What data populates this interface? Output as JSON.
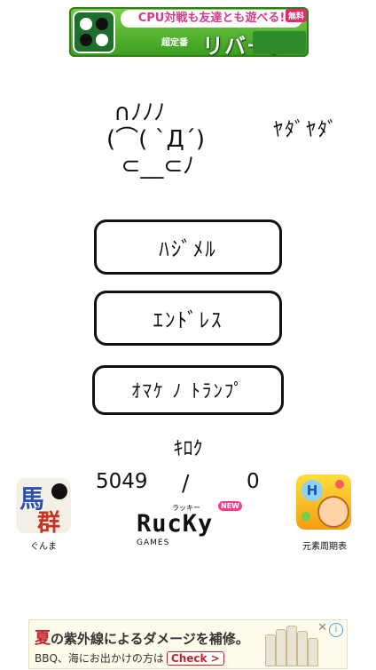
{
  "top_ad": {
    "headline": "CPU対戦も友達とも遊べる!",
    "badge": "無料",
    "subtitle": "超定番",
    "title": "リバーシ"
  },
  "kaomoji": {
    "face": " ∩ﾉﾉﾉ\n(⌒( `Д´)\n  ⊂__⊂ﾉ",
    "speech": "ﾔﾀﾞﾔﾀﾞ"
  },
  "menu": {
    "start_label": "ﾊｼﾞﾒﾙ",
    "endless_label": "ｴﾝﾄﾞﾚｽ",
    "bonus_label": "ｵﾏｹ ﾉ ﾄﾗﾝﾌﾟ"
  },
  "record": {
    "title": "ｷﾛｸ",
    "left_value": "5049",
    "separator": "/",
    "right_value": "0"
  },
  "apps": {
    "left_caption": "ぐんま",
    "left_icon_text_1": "馬",
    "left_icon_text_2": "群",
    "right_caption": "元素周期表",
    "right_icon_text": "H"
  },
  "brand": {
    "ruby": "ラッキー",
    "name": "RucKy",
    "new_badge": "NEW",
    "games": "GAMES"
  },
  "bottom_ad": {
    "line1_big": "夏",
    "line1_rest": "の紫外線によるダメージを補修。",
    "line2": "BBQ、海にお出かけの方は",
    "check_label": "Check >",
    "adchoice": "i",
    "close": "✕"
  },
  "colors": {
    "background": "#ffffff",
    "text": "#111111",
    "ad_green": "#3a9c1f",
    "ad_pink": "#d43b8c",
    "ad_red": "#c3272b"
  }
}
